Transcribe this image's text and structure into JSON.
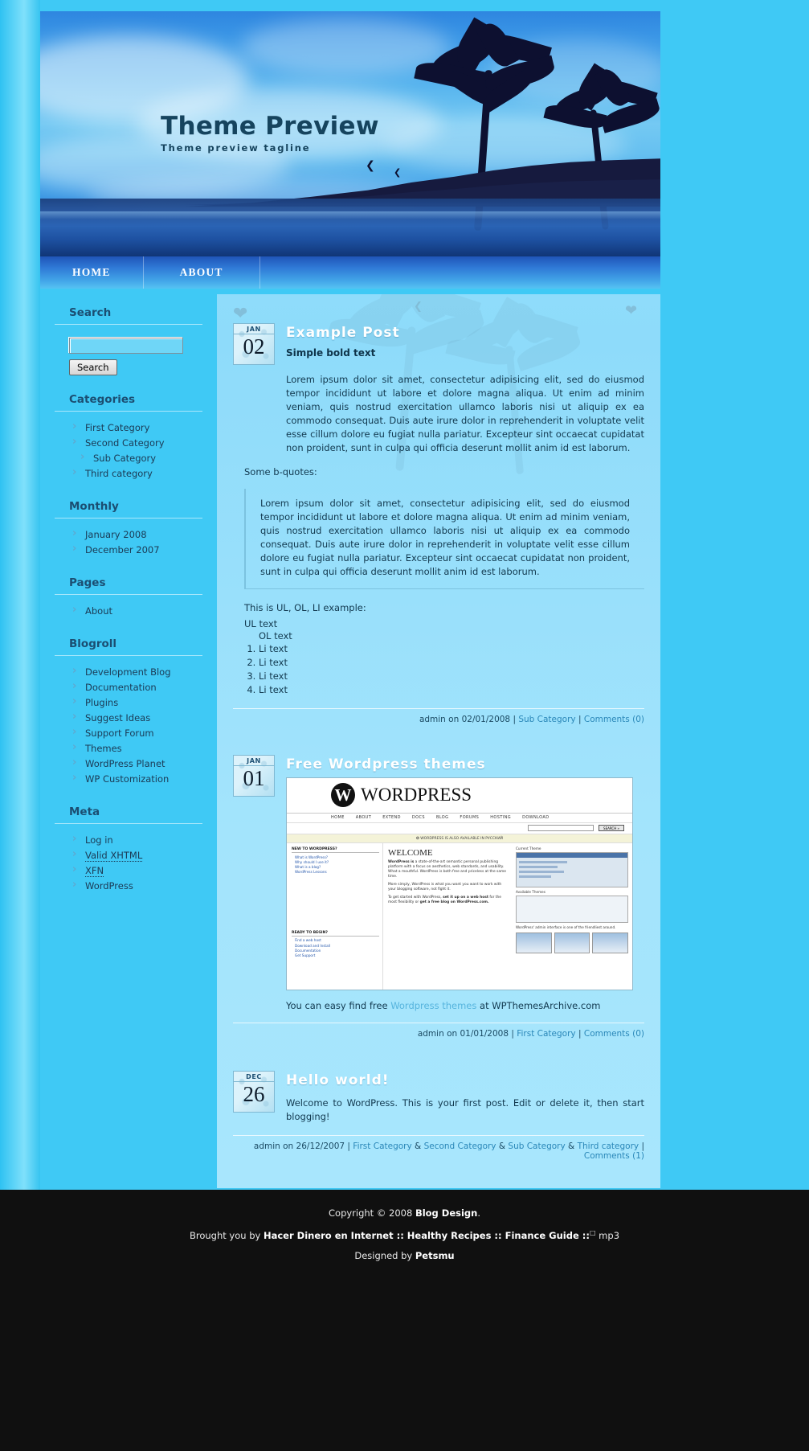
{
  "header": {
    "site_title": "Theme Preview",
    "site_tagline": "Theme preview tagline"
  },
  "nav": {
    "items": [
      {
        "label": "HOME"
      },
      {
        "label": "ABOUT"
      }
    ]
  },
  "sidebar": {
    "widgets": [
      {
        "title": "Search",
        "type": "search",
        "input_value": "",
        "input_placeholder": "",
        "button_label": "Search"
      },
      {
        "title": "Categories",
        "type": "list",
        "items": [
          {
            "label": "First Category",
            "sub": false
          },
          {
            "label": "Second Category",
            "sub": false
          },
          {
            "label": "Sub Category",
            "sub": true
          },
          {
            "label": "Third category",
            "sub": false
          }
        ]
      },
      {
        "title": "Monthly",
        "type": "list",
        "items": [
          {
            "label": "January 2008",
            "sub": false
          },
          {
            "label": "December 2007",
            "sub": false
          }
        ]
      },
      {
        "title": "Pages",
        "type": "list",
        "items": [
          {
            "label": "About",
            "sub": false
          }
        ]
      },
      {
        "title": "Blogroll",
        "type": "list",
        "items": [
          {
            "label": "Development Blog",
            "sub": false
          },
          {
            "label": "Documentation",
            "sub": false
          },
          {
            "label": "Plugins",
            "sub": false
          },
          {
            "label": "Suggest Ideas",
            "sub": false
          },
          {
            "label": "Support Forum",
            "sub": false
          },
          {
            "label": "Themes",
            "sub": false
          },
          {
            "label": "WordPress Planet",
            "sub": false
          },
          {
            "label": "WP Customization",
            "sub": false
          }
        ]
      },
      {
        "title": "Meta",
        "type": "list",
        "items": [
          {
            "label": "Log in",
            "sub": false,
            "dotted": false
          },
          {
            "label": "Valid XHTML",
            "sub": false,
            "dotted": true
          },
          {
            "label": "XFN",
            "sub": false,
            "dotted": true
          },
          {
            "label": "WordPress",
            "sub": false,
            "dotted": false
          }
        ]
      }
    ]
  },
  "posts": [
    {
      "month": "JAN",
      "day": "02",
      "title": "Example Post",
      "bold_text": "Simple bold text",
      "paragraph": "Lorem ipsum dolor sit amet, consectetur adipisicing elit, sed do eiusmod tempor incididunt ut labore et dolore magna aliqua. Ut enim ad minim veniam, quis nostrud exercitation ullamco laboris nisi ut aliquip ex ea commodo consequat. Duis aute irure dolor in reprehenderit in voluptate velit esse cillum dolore eu fugiat nulla pariatur. Excepteur sint occaecat cupidatat non proident, sunt in culpa qui officia deserunt mollit anim id est laborum.",
      "bquote_intro": "Some b-quotes:",
      "blockquote": "Lorem ipsum dolor sit amet, consectetur adipisicing elit, sed do eiusmod tempor incididunt ut labore et dolore magna aliqua. Ut enim ad minim veniam, quis nostrud exercitation ullamco laboris nisi ut aliquip ex ea commodo consequat. Duis aute irure dolor in reprehenderit in voluptate velit esse cillum dolore eu fugiat nulla pariatur. Excepteur sint occaecat cupidatat non proident, sunt in culpa qui officia deserunt mollit anim id est laborum.",
      "list_intro": "This is UL, OL, LI example:",
      "ul_items": [
        "UL text"
      ],
      "ol_label": "OL text",
      "ol_items": [
        "Li text",
        "Li text",
        "Li text",
        "Li text"
      ],
      "meta": {
        "author_prefix": "admin on ",
        "date": "02/01/2008",
        "sep1": " | ",
        "category": "Sub Category",
        "sep2": " | ",
        "comments": "Comments (0)"
      }
    },
    {
      "month": "JAN",
      "day": "01",
      "title": "Free Wordpress themes",
      "caption_before": "You can easy find free ",
      "caption_link": "Wordpress themes",
      "caption_after": " at WPThemesArchive.com",
      "meta": {
        "author_prefix": "admin on ",
        "date": "01/01/2008",
        "sep1": " | ",
        "category": "First Category",
        "sep2": " | ",
        "comments": "Comments (0)"
      },
      "screenshot": {
        "logo_letter": "W",
        "wordmark": "WORDPRESS",
        "menu": [
          "HOME",
          "ABOUT",
          "EXTEND",
          "DOCS",
          "BLOG",
          "FORUMS",
          "HOSTING",
          "DOWNLOAD"
        ],
        "search_button": "SEARCH »",
        "banner": "✪ WORDPRESS IS ALSO AVAILABLE IN РУССКИЙ",
        "welcome_heading": "WELCOME",
        "left_col": {
          "head1": "NEW TO WORDPRESS?",
          "items1": [
            "What is WordPress?",
            "Why should I use it?",
            "What is a blog?",
            "WordPress Lessons"
          ],
          "head2": "READY TO BEGIN?",
          "items2": [
            "Find a web host",
            "Download and Install",
            "Documentation",
            "Get Support"
          ]
        },
        "mid_col": {
          "p1_bold": "WordPress is",
          "p1": "a state-of-the-art semantic personal publishing platform with a focus on aesthetics, web standards, and usability. What a mouthful. WordPress is both free and priceless at the same time.",
          "p2": "More simply, WordPress is what you want you want to work with your blogging software, not fight it.",
          "p3_lead": "To get started with WordPress,",
          "p3_bold": "set it up on a web host",
          "p3_rest": "for the most flexibility or",
          "p3_bold2": "get a free blog on WordPress.com."
        },
        "right_col": {
          "cap1": "Current Theme",
          "cap2": "Available Themes",
          "cap3": "WordPress' admin interface is one of the friendliest around."
        }
      }
    },
    {
      "month": "DEC",
      "day": "26",
      "title": "Hello world!",
      "paragraph": "Welcome to WordPress. This is your first post. Edit or delete it, then start blogging!",
      "meta": {
        "author_prefix": "admin on ",
        "date": "26/12/2007",
        "sep1": " | ",
        "categories": [
          "First Category",
          "Second Category",
          "Sub Category",
          "Third category"
        ],
        "cat_sep": " & ",
        "sep2": " | ",
        "comments": "Comments (1)"
      }
    }
  ],
  "footer": {
    "line1_pre": "Copyright © 2008 ",
    "line1_bold": "Blog Design",
    "line1_post": ".",
    "line2_pre": "Brought you by ",
    "line2_bold": "Hacer Dinero en Internet :: Healthy Recipes :: Finance Guide ::",
    "line2_sup": "□",
    "line2_post": " mp3",
    "line3_pre": "Designed by ",
    "line3_bold": "Petsmu"
  }
}
